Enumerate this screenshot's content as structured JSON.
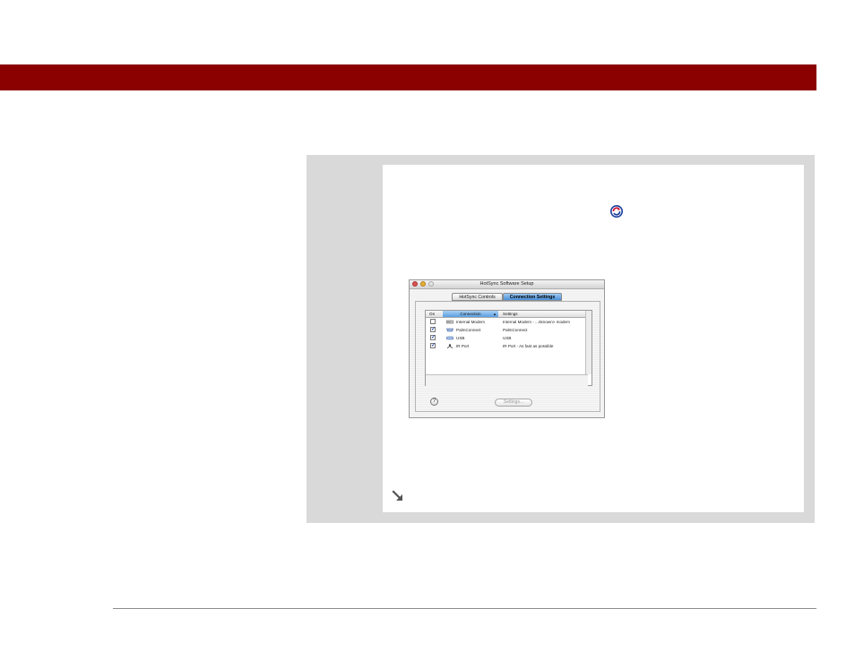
{
  "dialog": {
    "title": "HotSync Software Setup",
    "tabs": [
      {
        "label": "HotSync Controls",
        "selected": false
      },
      {
        "label": "Connection Settings",
        "selected": true
      }
    ],
    "columns": {
      "on": "On",
      "connection": "Connection",
      "sort_indicator": "▲",
      "settings": "Settings"
    },
    "rows": [
      {
        "on": false,
        "check": "",
        "connection": "Internal Modem",
        "settings": "Internal Modem - ...nknown> modem",
        "icon": "modem-icon"
      },
      {
        "on": true,
        "check": "✓",
        "connection": "PalmConnect",
        "settings": "PalmConnect",
        "icon": "serial-port-icon"
      },
      {
        "on": true,
        "check": "✓",
        "connection": "USB",
        "settings": "USB",
        "icon": "usb-icon"
      },
      {
        "on": true,
        "check": "✓",
        "connection": "IR Port",
        "settings": "IR Port - As fast as possible",
        "icon": "ir-port-icon"
      }
    ],
    "help_label": "?",
    "settings_button": "Settings..."
  },
  "icons": {
    "inline": "hotsync-icon",
    "continue": "continue-arrow-icon"
  },
  "colors": {
    "header_bar": "#8b0000",
    "panel": "#d9d9d9",
    "selected_tab": "#4a90d9"
  }
}
